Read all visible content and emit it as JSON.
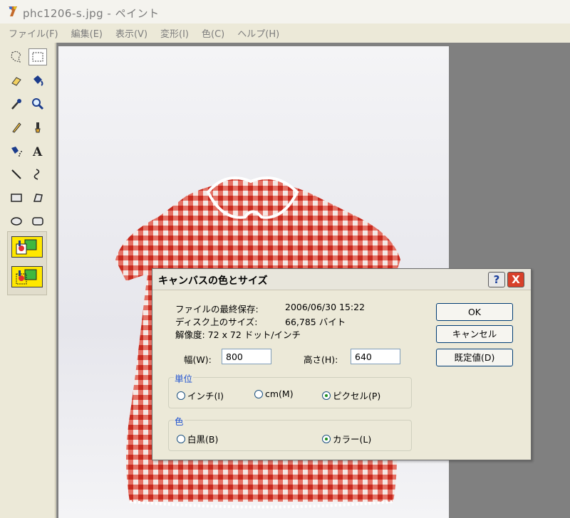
{
  "window": {
    "title": "phc1206-s.jpg - ペイント"
  },
  "menu": [
    "ファイル(F)",
    "編集(E)",
    "表示(V)",
    "変形(I)",
    "色(C)",
    "ヘルプ(H)"
  ],
  "tools": [
    "free-select-icon",
    "rect-select-icon",
    "eraser-icon",
    "fill-bucket-icon",
    "color-picker-icon",
    "magnifier-icon",
    "pencil-icon",
    "brush-icon",
    "airbrush-icon",
    "text-icon",
    "line-icon",
    "curve-icon",
    "rectangle-icon",
    "polygon-icon",
    "ellipse-icon",
    "rounded-rect-icon"
  ],
  "dialog": {
    "title": "キャンバスの色とサイズ",
    "help": "?",
    "close": "X",
    "last_saved_label": "ファイルの最終保存:",
    "last_saved_value": "2006/06/30 15:22",
    "disk_size_label": "ディスク上のサイズ:",
    "disk_size_value": "66,785 バイト",
    "resolution": "解像度: 72 x 72 ドット/インチ",
    "width_label": "幅(W):",
    "width_value": "800",
    "height_label": "高さ(H):",
    "height_value": "640",
    "units_label": "単位",
    "unit_inch": "インチ(I)",
    "unit_cm": "cm(M)",
    "unit_pixel": "ピクセル(P)",
    "color_label": "色",
    "color_bw": "白黒(B)",
    "color_color": "カラー(L)",
    "ok": "OK",
    "cancel": "キャンセル",
    "default": "既定値(D)"
  }
}
